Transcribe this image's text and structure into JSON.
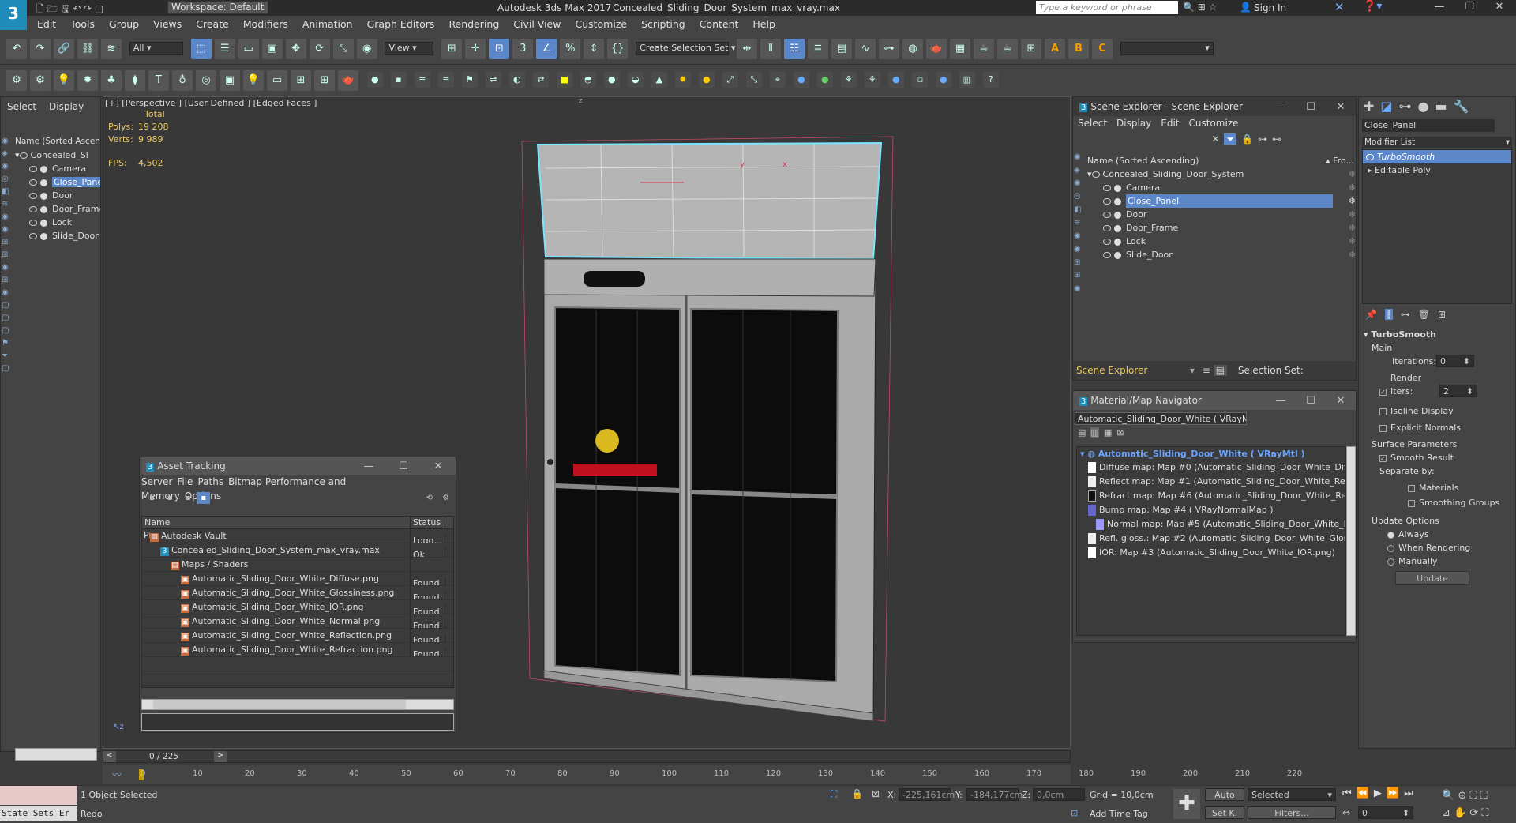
{
  "app": {
    "logo": "3",
    "workspace": "Workspace: Default",
    "title": "Autodesk 3ds Max 2017",
    "file": "Concealed_Sliding_Door_System_max_vray.max",
    "search_placeholder": "Type a keyword or phrase",
    "sign_in": "Sign In"
  },
  "menu": [
    "Edit",
    "Tools",
    "Group",
    "Views",
    "Create",
    "Modifiers",
    "Animation",
    "Graph Editors",
    "Rendering",
    "Civil View",
    "Customize",
    "Scripting",
    "Content",
    "Help"
  ],
  "toolbar": {
    "filter": "All",
    "view": "View",
    "selection_set": "Create Selection Set"
  },
  "left_tabs": {
    "select": "Select",
    "display": "Display"
  },
  "left_scene": {
    "header": "Name (Sorted Ascend",
    "root": "Concealed_Sl",
    "items": [
      "Camera",
      "Close_Pane",
      "Door",
      "Door_Frame",
      "Lock",
      "Slide_Door"
    ],
    "selected": 1
  },
  "viewport": {
    "label": "[+] [Perspective ] [User Defined ] [Edged Faces ]",
    "stats": {
      "total": "Total",
      "polys_label": "Polys:",
      "polys": "19 208",
      "verts_label": "Verts:",
      "verts": "9 989",
      "fps_label": "FPS:",
      "fps": "4,502"
    },
    "axis_y": "y",
    "axis_x": "x",
    "axis_z": "z"
  },
  "scene_explorer": {
    "title": "Scene Explorer - Scene Explorer",
    "menu": [
      "Select",
      "Display",
      "Edit",
      "Customize"
    ],
    "col_name": "Name (Sorted Ascending)",
    "col_fro": "▴ Fro...",
    "root": "Concealed_Sliding_Door_System",
    "items": [
      "Camera",
      "Close_Panel",
      "Door",
      "Door_Frame",
      "Lock",
      "Slide_Door"
    ],
    "selected": 1,
    "footer_label": "Scene Explorer",
    "selection_set": "Selection Set:"
  },
  "material_nav": {
    "title": "Material/Map Navigator",
    "current": "Automatic_Sliding_Door_White  ( VRayMtl )",
    "root": "Automatic_Sliding_Door_White  ( VRayMtl )",
    "items": [
      "Diffuse map: Map #0 (Automatic_Sliding_Door_White_Diffuse.p",
      "Reflect map: Map #1 (Automatic_Sliding_Door_White_Reflectio",
      "Refract map: Map #6 (Automatic_Sliding_Door_White_Refractic",
      "Bump map: Map #4  ( VRayNormalMap )",
      "Normal map: Map #5 (Automatic_Sliding_Door_White_Norma",
      "Refl. gloss.: Map #2 (Automatic_Sliding_Door_White_Glossiness",
      "IOR: Map #3 (Automatic_Sliding_Door_White_IOR.png)"
    ]
  },
  "asset_tracking": {
    "title": "Asset Tracking",
    "menu": [
      "Server",
      "File",
      "Paths",
      "Bitmap Performance and Memory",
      "Options"
    ],
    "col_name": "Name",
    "col_status": "Status",
    "col_p": "Pr",
    "rows": [
      {
        "name": "Autodesk Vault",
        "status": "Logg...",
        "indent": 0
      },
      {
        "name": "Concealed_Sliding_Door_System_max_vray.max",
        "status": "Ok",
        "indent": 1
      },
      {
        "name": "Maps / Shaders",
        "status": "",
        "indent": 2
      },
      {
        "name": "Automatic_Sliding_Door_White_Diffuse.png",
        "status": "Found",
        "indent": 3
      },
      {
        "name": "Automatic_Sliding_Door_White_Glossiness.png",
        "status": "Found",
        "indent": 3
      },
      {
        "name": "Automatic_Sliding_Door_White_IOR.png",
        "status": "Found",
        "indent": 3
      },
      {
        "name": "Automatic_Sliding_Door_White_Normal.png",
        "status": "Found",
        "indent": 3
      },
      {
        "name": "Automatic_Sliding_Door_White_Reflection.png",
        "status": "Found",
        "indent": 3
      },
      {
        "name": "Automatic_Sliding_Door_White_Refraction.png",
        "status": "Found",
        "indent": 3
      }
    ]
  },
  "modify": {
    "object_name": "Close_Panel",
    "modifier_list": "Modifier List",
    "stack": [
      "TurboSmooth",
      "Editable Poly"
    ],
    "rollout": "TurboSmooth",
    "main": "Main",
    "iterations_label": "Iterations:",
    "iterations": "0",
    "render_iters_label": "Render Iters:",
    "render_iters": "2",
    "isoline": "Isoline Display",
    "explicit": "Explicit Normals",
    "surface": "Surface Parameters",
    "smooth_result": "Smooth Result",
    "separate": "Separate by:",
    "materials": "Materials",
    "smoothing": "Smoothing Groups",
    "update_opts": "Update Options",
    "always": "Always",
    "when_rendering": "When Rendering",
    "manually": "Manually",
    "update_btn": "Update"
  },
  "timeline": {
    "frame": "0 / 225",
    "ticks": [
      "0",
      "10",
      "20",
      "30",
      "40",
      "50",
      "60",
      "70",
      "80",
      "90",
      "100",
      "110",
      "120",
      "130",
      "140",
      "150",
      "160",
      "170",
      "180",
      "190",
      "200",
      "210",
      "220"
    ]
  },
  "status": {
    "selected": "1 Object Selected",
    "prompt": "Redo",
    "state_sets": "State Sets Er",
    "x_label": "X:",
    "x": "-225,161cm",
    "y_label": "Y:",
    "y": "-184,177cm",
    "z_label": "Z:",
    "z": "0,0cm",
    "grid": "Grid = 10,0cm",
    "add_time_tag": "Add Time Tag",
    "auto": "Auto",
    "set_k": "Set K.",
    "selected_dd": "Selected",
    "filters": "Filters...",
    "frame_field": "0"
  }
}
